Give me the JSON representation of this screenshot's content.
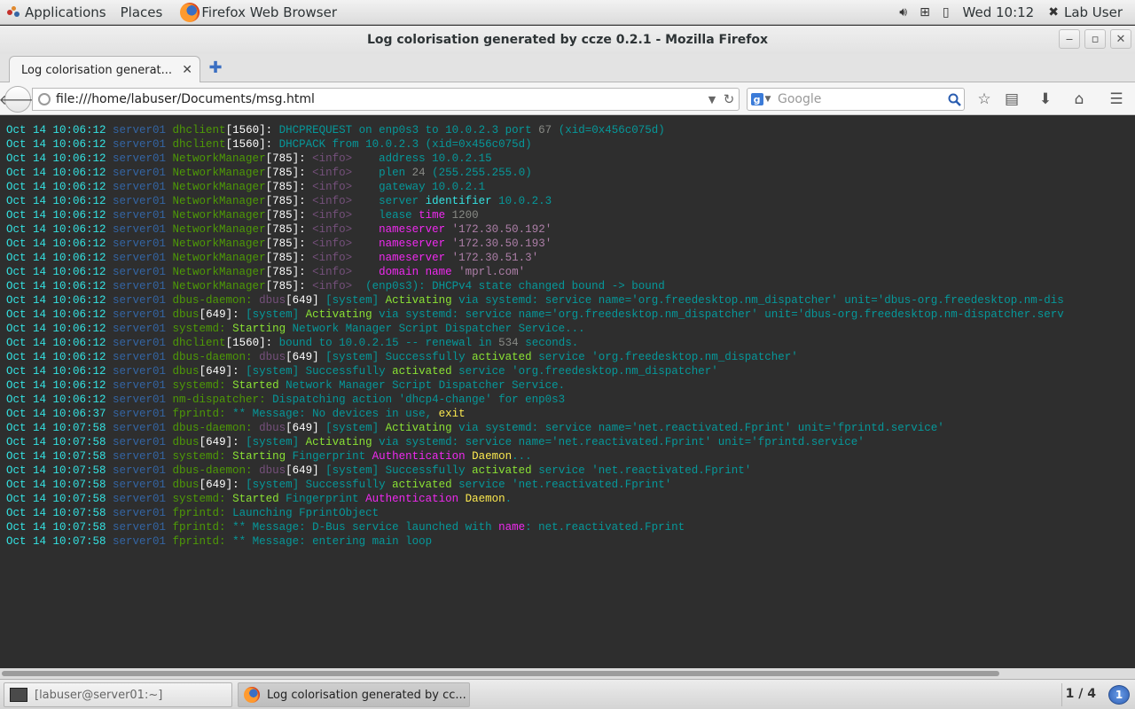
{
  "topbar": {
    "applications": "Applications",
    "places": "Places",
    "active_app": "Firefox Web Browser",
    "clock": "Wed 10:12",
    "user": "Lab User"
  },
  "window": {
    "title": "Log colorisation generated by ccze 0.2.1 - Mozilla Firefox"
  },
  "tab": {
    "title": "Log colorisation generat..."
  },
  "nav": {
    "url": "file:///home/labuser/Documents/msg.html",
    "search_placeholder": "Google"
  },
  "log": [
    [
      [
        "Oct 14 10:06:12",
        "c-ts"
      ],
      [
        " server01 ",
        "c-host"
      ],
      [
        "dhclient",
        "c-proc"
      ],
      [
        "[",
        "c-brack"
      ],
      [
        "1560",
        "c-pid"
      ],
      [
        "]: ",
        "c-brack"
      ],
      [
        "DHCPREQUEST on enp0s3 to ",
        "c-msg"
      ],
      [
        "10.0.2.3",
        "c-ip"
      ],
      [
        " port ",
        "c-msg"
      ],
      [
        "67",
        "c-grey"
      ],
      [
        " (xid=0x456c075d)",
        "c-msg"
      ]
    ],
    [
      [
        "Oct 14 10:06:12",
        "c-ts"
      ],
      [
        " server01 ",
        "c-host"
      ],
      [
        "dhclient",
        "c-proc"
      ],
      [
        "[",
        "c-brack"
      ],
      [
        "1560",
        "c-pid"
      ],
      [
        "]: ",
        "c-brack"
      ],
      [
        "DHCPACK from ",
        "c-msg"
      ],
      [
        "10.0.2.3",
        "c-ip"
      ],
      [
        " (xid=0x456c075d)",
        "c-msg"
      ]
    ],
    [
      [
        "Oct 14 10:06:12",
        "c-ts"
      ],
      [
        " server01 ",
        "c-host"
      ],
      [
        "NetworkManager",
        "c-proc"
      ],
      [
        "[",
        "c-brack"
      ],
      [
        "785",
        "c-pid"
      ],
      [
        "]: ",
        "c-brack"
      ],
      [
        "<info>",
        "c-info"
      ],
      [
        "    address ",
        "c-msg"
      ],
      [
        "10.0.2.15",
        "c-ip"
      ]
    ],
    [
      [
        "Oct 14 10:06:12",
        "c-ts"
      ],
      [
        " server01 ",
        "c-host"
      ],
      [
        "NetworkManager",
        "c-proc"
      ],
      [
        "[",
        "c-brack"
      ],
      [
        "785",
        "c-pid"
      ],
      [
        "]: ",
        "c-brack"
      ],
      [
        "<info>",
        "c-info"
      ],
      [
        "    plen ",
        "c-msg"
      ],
      [
        "24",
        "c-grey"
      ],
      [
        " (255.255.255.0)",
        "c-msg"
      ]
    ],
    [
      [
        "Oct 14 10:06:12",
        "c-ts"
      ],
      [
        " server01 ",
        "c-host"
      ],
      [
        "NetworkManager",
        "c-proc"
      ],
      [
        "[",
        "c-brack"
      ],
      [
        "785",
        "c-pid"
      ],
      [
        "]: ",
        "c-brack"
      ],
      [
        "<info>",
        "c-info"
      ],
      [
        "    gateway ",
        "c-msg"
      ],
      [
        "10.0.2.1",
        "c-ip"
      ]
    ],
    [
      [
        "Oct 14 10:06:12",
        "c-ts"
      ],
      [
        " server01 ",
        "c-host"
      ],
      [
        "NetworkManager",
        "c-proc"
      ],
      [
        "[",
        "c-brack"
      ],
      [
        "785",
        "c-pid"
      ],
      [
        "]: ",
        "c-brack"
      ],
      [
        "<info>",
        "c-info"
      ],
      [
        "    server ",
        "c-msg"
      ],
      [
        "identifier",
        "c-cyanb"
      ],
      [
        " 10.0.2.3",
        "c-ip"
      ]
    ],
    [
      [
        "Oct 14 10:06:12",
        "c-ts"
      ],
      [
        " server01 ",
        "c-host"
      ],
      [
        "NetworkManager",
        "c-proc"
      ],
      [
        "[",
        "c-brack"
      ],
      [
        "785",
        "c-pid"
      ],
      [
        "]: ",
        "c-brack"
      ],
      [
        "<info>",
        "c-info"
      ],
      [
        "    lease ",
        "c-msg"
      ],
      [
        "time",
        "c-hl"
      ],
      [
        " 1200",
        "c-grey"
      ]
    ],
    [
      [
        "Oct 14 10:06:12",
        "c-ts"
      ],
      [
        " server01 ",
        "c-host"
      ],
      [
        "NetworkManager",
        "c-proc"
      ],
      [
        "[",
        "c-brack"
      ],
      [
        "785",
        "c-pid"
      ],
      [
        "]: ",
        "c-brack"
      ],
      [
        "<info>",
        "c-info"
      ],
      [
        "    ",
        "c-msg"
      ],
      [
        "nameserver",
        "c-hl"
      ],
      [
        " '172.30.50.192'",
        "c-mag"
      ]
    ],
    [
      [
        "Oct 14 10:06:12",
        "c-ts"
      ],
      [
        " server01 ",
        "c-host"
      ],
      [
        "NetworkManager",
        "c-proc"
      ],
      [
        "[",
        "c-brack"
      ],
      [
        "785",
        "c-pid"
      ],
      [
        "]: ",
        "c-brack"
      ],
      [
        "<info>",
        "c-info"
      ],
      [
        "    ",
        "c-msg"
      ],
      [
        "nameserver",
        "c-hl"
      ],
      [
        " '172.30.50.193'",
        "c-mag"
      ]
    ],
    [
      [
        "Oct 14 10:06:12",
        "c-ts"
      ],
      [
        " server01 ",
        "c-host"
      ],
      [
        "NetworkManager",
        "c-proc"
      ],
      [
        "[",
        "c-brack"
      ],
      [
        "785",
        "c-pid"
      ],
      [
        "]: ",
        "c-brack"
      ],
      [
        "<info>",
        "c-info"
      ],
      [
        "    ",
        "c-msg"
      ],
      [
        "nameserver",
        "c-hl"
      ],
      [
        " '172.30.51.3'",
        "c-mag"
      ]
    ],
    [
      [
        "Oct 14 10:06:12",
        "c-ts"
      ],
      [
        " server01 ",
        "c-host"
      ],
      [
        "NetworkManager",
        "c-proc"
      ],
      [
        "[",
        "c-brack"
      ],
      [
        "785",
        "c-pid"
      ],
      [
        "]: ",
        "c-brack"
      ],
      [
        "<info>",
        "c-info"
      ],
      [
        "    ",
        "c-msg"
      ],
      [
        "domain name",
        "c-hl"
      ],
      [
        " 'mprl.com'",
        "c-mag"
      ]
    ],
    [
      [
        "Oct 14 10:06:12",
        "c-ts"
      ],
      [
        " server01 ",
        "c-host"
      ],
      [
        "NetworkManager",
        "c-proc"
      ],
      [
        "[",
        "c-brack"
      ],
      [
        "785",
        "c-pid"
      ],
      [
        "]: ",
        "c-brack"
      ],
      [
        "<info>",
        "c-info"
      ],
      [
        "  (enp0s3): DHCPv4 state changed bound -> bound",
        "c-msg"
      ]
    ],
    [
      [
        "Oct 14 10:06:12",
        "c-ts"
      ],
      [
        " server01 ",
        "c-host"
      ],
      [
        "dbus-daemon: ",
        "c-proc"
      ],
      [
        "dbus",
        "c-info"
      ],
      [
        "[",
        "c-brack"
      ],
      [
        "649",
        "c-pid"
      ],
      [
        "] ",
        "c-brack"
      ],
      [
        "[system] ",
        "c-msg"
      ],
      [
        "Activating",
        "c-kw"
      ],
      [
        " via systemd: service name='org.freedesktop.nm_dispatcher' unit='dbus-org.freedesktop.nm-dis",
        "c-msg"
      ]
    ],
    [
      [
        "Oct 14 10:06:12",
        "c-ts"
      ],
      [
        " server01 ",
        "c-host"
      ],
      [
        "dbus",
        "c-proc"
      ],
      [
        "[",
        "c-brack"
      ],
      [
        "649",
        "c-pid"
      ],
      [
        "]: ",
        "c-brack"
      ],
      [
        "[system] ",
        "c-msg"
      ],
      [
        "Activating",
        "c-kw"
      ],
      [
        " via systemd: service name='org.freedesktop.nm_dispatcher' unit='dbus-org.freedesktop.nm-dispatcher.serv",
        "c-msg"
      ]
    ],
    [
      [
        "Oct 14 10:06:12",
        "c-ts"
      ],
      [
        " server01 ",
        "c-host"
      ],
      [
        "systemd: ",
        "c-proc"
      ],
      [
        "Starting",
        "c-kw"
      ],
      [
        " Network Manager Script Dispatcher Service...",
        "c-msg"
      ]
    ],
    [
      [
        "Oct 14 10:06:12",
        "c-ts"
      ],
      [
        " server01 ",
        "c-host"
      ],
      [
        "dhclient",
        "c-proc"
      ],
      [
        "[",
        "c-brack"
      ],
      [
        "1560",
        "c-pid"
      ],
      [
        "]: ",
        "c-brack"
      ],
      [
        "bound to ",
        "c-msg"
      ],
      [
        "10.0.2.15",
        "c-ip"
      ],
      [
        " -- renewal in ",
        "c-msg"
      ],
      [
        "534",
        "c-grey"
      ],
      [
        " seconds.",
        "c-msg"
      ]
    ],
    [
      [
        "Oct 14 10:06:12",
        "c-ts"
      ],
      [
        " server01 ",
        "c-host"
      ],
      [
        "dbus-daemon: ",
        "c-proc"
      ],
      [
        "dbus",
        "c-info"
      ],
      [
        "[",
        "c-brack"
      ],
      [
        "649",
        "c-pid"
      ],
      [
        "] ",
        "c-brack"
      ],
      [
        "[system] Successfully ",
        "c-msg"
      ],
      [
        "activated",
        "c-kw"
      ],
      [
        " service 'org.freedesktop.nm_dispatcher'",
        "c-msg"
      ]
    ],
    [
      [
        "Oct 14 10:06:12",
        "c-ts"
      ],
      [
        " server01 ",
        "c-host"
      ],
      [
        "dbus",
        "c-proc"
      ],
      [
        "[",
        "c-brack"
      ],
      [
        "649",
        "c-pid"
      ],
      [
        "]: ",
        "c-brack"
      ],
      [
        "[system] Successfully ",
        "c-msg"
      ],
      [
        "activated",
        "c-kw"
      ],
      [
        " service 'org.freedesktop.nm_dispatcher'",
        "c-msg"
      ]
    ],
    [
      [
        "Oct 14 10:06:12",
        "c-ts"
      ],
      [
        " server01 ",
        "c-host"
      ],
      [
        "systemd: ",
        "c-proc"
      ],
      [
        "Started",
        "c-kw"
      ],
      [
        " Network Manager Script Dispatcher Service.",
        "c-msg"
      ]
    ],
    [
      [
        "Oct 14 10:06:12",
        "c-ts"
      ],
      [
        " server01 ",
        "c-host"
      ],
      [
        "nm-dispatcher: ",
        "c-proc"
      ],
      [
        "Dispatching action 'dhcp4-change' for enp0s3",
        "c-msg"
      ]
    ],
    [
      [
        "Oct 14 10:06:37",
        "c-ts"
      ],
      [
        " server01 ",
        "c-host"
      ],
      [
        "fprintd: ",
        "c-proc"
      ],
      [
        "** Message: No devices in use, ",
        "c-msg"
      ],
      [
        "exit",
        "c-yel"
      ]
    ],
    [
      [
        "Oct 14 10:07:58",
        "c-ts"
      ],
      [
        " server01 ",
        "c-host"
      ],
      [
        "dbus-daemon: ",
        "c-proc"
      ],
      [
        "dbus",
        "c-info"
      ],
      [
        "[",
        "c-brack"
      ],
      [
        "649",
        "c-pid"
      ],
      [
        "] ",
        "c-brack"
      ],
      [
        "[system] ",
        "c-msg"
      ],
      [
        "Activating",
        "c-kw"
      ],
      [
        " via systemd: service name='net.reactivated.Fprint' unit='fprintd.service'",
        "c-msg"
      ]
    ],
    [
      [
        "Oct 14 10:07:58",
        "c-ts"
      ],
      [
        " server01 ",
        "c-host"
      ],
      [
        "dbus",
        "c-proc"
      ],
      [
        "[",
        "c-brack"
      ],
      [
        "649",
        "c-pid"
      ],
      [
        "]: ",
        "c-brack"
      ],
      [
        "[system] ",
        "c-msg"
      ],
      [
        "Activating",
        "c-kw"
      ],
      [
        " via systemd: service name='net.reactivated.Fprint' unit='fprintd.service'",
        "c-msg"
      ]
    ],
    [
      [
        "Oct 14 10:07:58",
        "c-ts"
      ],
      [
        " server01 ",
        "c-host"
      ],
      [
        "systemd: ",
        "c-proc"
      ],
      [
        "Starting",
        "c-kw"
      ],
      [
        " Fingerprint ",
        "c-msg"
      ],
      [
        "Authentication",
        "c-hl"
      ],
      [
        " ",
        "c-msg"
      ],
      [
        "Daemon",
        "c-yel"
      ],
      [
        "...",
        "c-msg"
      ]
    ],
    [
      [
        "Oct 14 10:07:58",
        "c-ts"
      ],
      [
        " server01 ",
        "c-host"
      ],
      [
        "dbus-daemon: ",
        "c-proc"
      ],
      [
        "dbus",
        "c-info"
      ],
      [
        "[",
        "c-brack"
      ],
      [
        "649",
        "c-pid"
      ],
      [
        "] ",
        "c-brack"
      ],
      [
        "[system] Successfully ",
        "c-msg"
      ],
      [
        "activated",
        "c-kw"
      ],
      [
        " service 'net.reactivated.Fprint'",
        "c-msg"
      ]
    ],
    [
      [
        "Oct 14 10:07:58",
        "c-ts"
      ],
      [
        " server01 ",
        "c-host"
      ],
      [
        "dbus",
        "c-proc"
      ],
      [
        "[",
        "c-brack"
      ],
      [
        "649",
        "c-pid"
      ],
      [
        "]: ",
        "c-brack"
      ],
      [
        "[system] Successfully ",
        "c-msg"
      ],
      [
        "activated",
        "c-kw"
      ],
      [
        " service 'net.reactivated.Fprint'",
        "c-msg"
      ]
    ],
    [
      [
        "Oct 14 10:07:58",
        "c-ts"
      ],
      [
        " server01 ",
        "c-host"
      ],
      [
        "systemd: ",
        "c-proc"
      ],
      [
        "Started",
        "c-kw"
      ],
      [
        " Fingerprint ",
        "c-msg"
      ],
      [
        "Authentication",
        "c-hl"
      ],
      [
        " ",
        "c-msg"
      ],
      [
        "Daemon",
        "c-yel"
      ],
      [
        ".",
        "c-msg"
      ]
    ],
    [
      [
        "Oct 14 10:07:58",
        "c-ts"
      ],
      [
        " server01 ",
        "c-host"
      ],
      [
        "fprintd: ",
        "c-proc"
      ],
      [
        "Launching FprintObject",
        "c-msg"
      ]
    ],
    [
      [
        "Oct 14 10:07:58",
        "c-ts"
      ],
      [
        " server01 ",
        "c-host"
      ],
      [
        "fprintd: ",
        "c-proc"
      ],
      [
        "** Message: D-Bus service launched with ",
        "c-msg"
      ],
      [
        "name",
        "c-hl"
      ],
      [
        ": net.reactivated.Fprint",
        "c-msg"
      ]
    ],
    [
      [
        "Oct 14 10:07:58",
        "c-ts"
      ],
      [
        " server01 ",
        "c-host"
      ],
      [
        "fprintd: ",
        "c-proc"
      ],
      [
        "** Message: entering main loop",
        "c-msg"
      ]
    ]
  ],
  "taskbar": {
    "terminal": "[labuser@server01:~]",
    "firefox": "Log colorisation generated by cc...",
    "workspace": "1 / 4",
    "notify_count": "1"
  }
}
